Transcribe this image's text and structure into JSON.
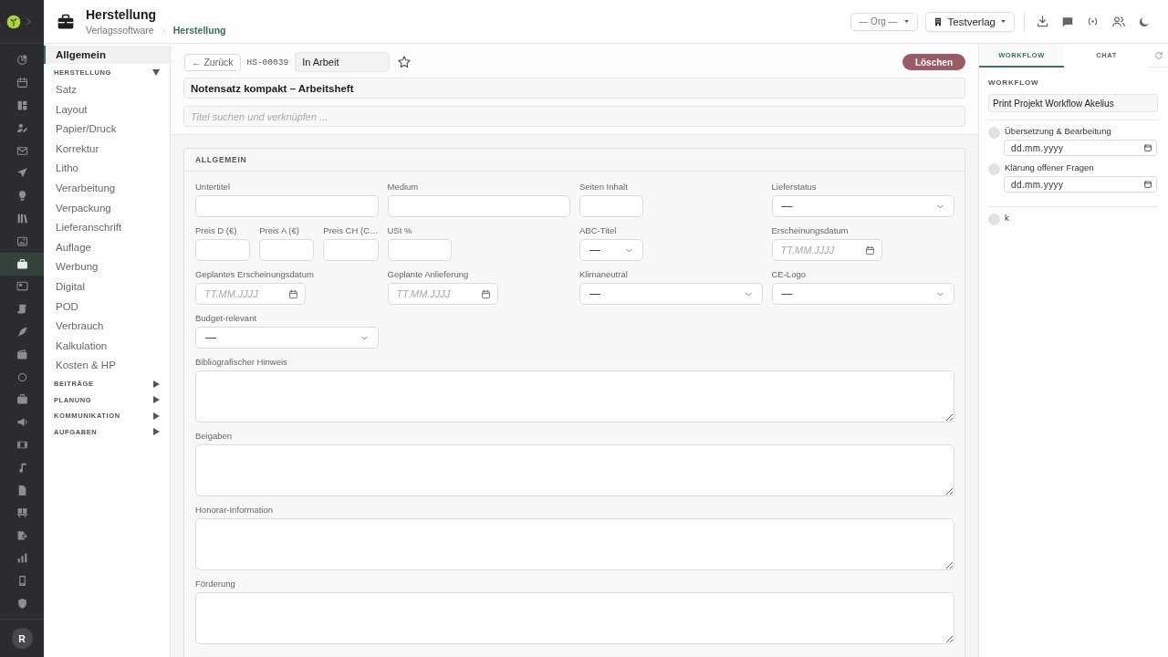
{
  "rail": {
    "items": [
      {
        "selected": false
      },
      {
        "selected": false
      },
      {
        "selected": false
      },
      {
        "selected": false
      },
      {
        "selected": false
      },
      {
        "selected": false
      },
      {
        "selected": false
      },
      {
        "selected": false
      },
      {
        "selected": false
      },
      {
        "selected": true
      },
      {
        "selected": false
      },
      {
        "selected": false
      },
      {
        "selected": false
      },
      {
        "selected": false
      },
      {
        "selected": false
      },
      {
        "selected": false
      },
      {
        "selected": false
      },
      {
        "selected": false
      },
      {
        "selected": false
      },
      {
        "selected": false
      },
      {
        "selected": false
      },
      {
        "selected": false
      },
      {
        "selected": false
      },
      {
        "selected": false
      },
      {
        "selected": false
      }
    ],
    "user": {
      "initial": "R"
    }
  },
  "header": {
    "title": "Herstellung",
    "breadcrumb": [
      "Verlagssoftware",
      "Herstellung"
    ],
    "org_select": {
      "value": "— Org —"
    },
    "tenant_select": {
      "value": "Testverlag"
    }
  },
  "sidebar": {
    "items": [
      {
        "label": "Allgemein",
        "selected": true
      }
    ],
    "sections": [
      {
        "label": "HERSTELLUNG",
        "expanded": true,
        "children": [
          {
            "label": "Satz",
            "selected": false
          },
          {
            "label": "Layout",
            "selected": false
          },
          {
            "label": "Papier/Druck",
            "selected": false
          },
          {
            "label": "Korrektur",
            "selected": false
          },
          {
            "label": "Litho",
            "selected": false
          },
          {
            "label": "Verarbeitung",
            "selected": false
          },
          {
            "label": "Verpackung",
            "selected": false
          },
          {
            "label": "Lieferanschrift",
            "selected": false
          },
          {
            "label": "Auflage",
            "selected": false
          },
          {
            "label": "Werbung",
            "selected": false
          },
          {
            "label": "Digital",
            "selected": false
          },
          {
            "label": "POD",
            "selected": false
          },
          {
            "label": "Verbrauch",
            "selected": false
          },
          {
            "label": "Kalkulation",
            "selected": false
          },
          {
            "label": "Kosten & HP",
            "selected": false
          }
        ]
      },
      {
        "label": "BEITRÄGE",
        "expanded": false
      },
      {
        "label": "PLANUNG",
        "expanded": false
      },
      {
        "label": "KOMMUNIKATION",
        "expanded": false
      },
      {
        "label": "AUFGABEN",
        "expanded": false
      }
    ]
  },
  "toolbar": {
    "back_button": "← Zurück",
    "record_id": "HS-00039",
    "status": {
      "value": "In Arbeit"
    },
    "starred": false,
    "delete_button": "Löschen"
  },
  "title_field": {
    "value": "Notensatz kompakt – Arbeitsheft"
  },
  "link_search": {
    "placeholder": "Titel suchen und verknüpfen ..."
  },
  "section": {
    "title": "ALLGEMEIN",
    "fields": [
      {
        "label": "Untertitel",
        "kind": "text"
      },
      {
        "label": "Medium",
        "kind": "text"
      },
      {
        "label": "Seiten Inhalt",
        "kind": "text"
      },
      {
        "label": "Lieferstatus",
        "kind": "select",
        "value": "—"
      },
      {
        "label": "Preis D (€)",
        "kind": "text"
      },
      {
        "label": "Preis A (€)",
        "kind": "text"
      },
      {
        "label": "Preis CH (C…",
        "kind": "text"
      },
      {
        "label": "USt %",
        "kind": "text"
      },
      {
        "label": "ABC-Titel",
        "kind": "select",
        "value": "—"
      },
      {
        "label": "Erscheinungsdatum",
        "kind": "date",
        "placeholder": "TT.MM.JJJJ"
      },
      {
        "label": "Geplantes Erscheinungsdatum",
        "kind": "date",
        "placeholder": "TT.MM.JJJJ"
      },
      {
        "label": "Geplante Anlieferung",
        "kind": "date",
        "placeholder": "TT.MM.JJJJ"
      },
      {
        "label": "Klimaneutral",
        "kind": "select",
        "value": "—"
      },
      {
        "label": "CE-Logo",
        "kind": "select",
        "value": "—"
      },
      {
        "label": "Budget-relevant",
        "kind": "select",
        "value": "—"
      },
      {
        "label": "Bibliografischer Hinweis",
        "kind": "textarea"
      },
      {
        "label": "Beigaben",
        "kind": "textarea"
      },
      {
        "label": "Honorar-Information",
        "kind": "textarea"
      },
      {
        "label": "Förderung",
        "kind": "textarea"
      }
    ]
  },
  "right_panel": {
    "tabs": [
      {
        "label": "WORKFLOW",
        "selected": true
      },
      {
        "label": "CHAT",
        "selected": false
      }
    ],
    "workflow": {
      "heading": "WORKFLOW",
      "name": {
        "value": "Print Projekt Workflow Akelius"
      },
      "phases": [
        {
          "steps": [
            {
              "label": "Übersetzung & Bearbeitung",
              "checked": false,
              "date": {
                "placeholder": "dd.mm.yyyy"
              }
            },
            {
              "label": "Klärung offener Fragen",
              "checked": false,
              "date": {
                "placeholder": "dd.mm.yyyy"
              }
            }
          ]
        },
        {
          "steps": [
            {
              "label": "k",
              "checked": false
            }
          ]
        }
      ]
    }
  }
}
